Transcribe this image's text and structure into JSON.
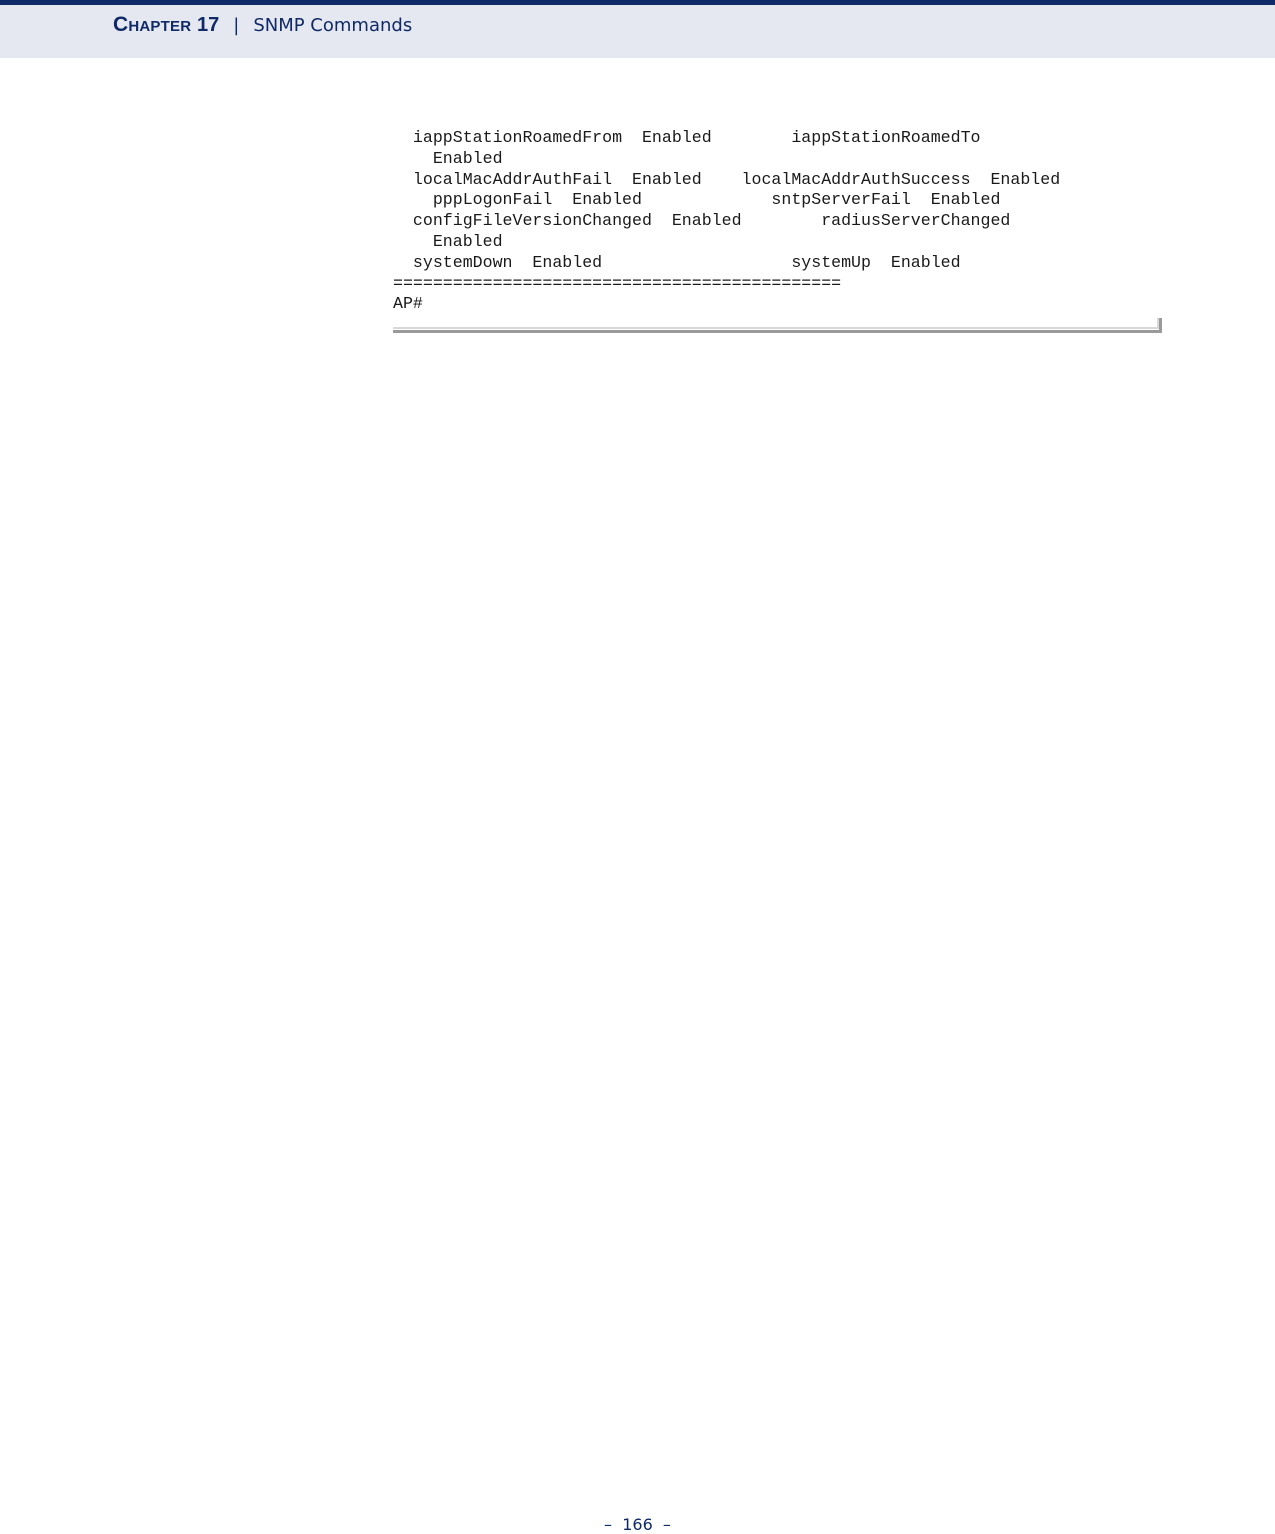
{
  "header": {
    "chapter_label": "Chapter",
    "chapter_number": "17",
    "separator": "|",
    "section_title": "SNMP Commands"
  },
  "code_example": {
    "lines": [
      "  iappStationRoamedFrom  Enabled        iappStationRoamedTo",
      "    Enabled",
      "  localMacAddrAuthFail  Enabled    localMacAddrAuthSuccess  Enabled",
      "    pppLogonFail  Enabled             sntpServerFail  Enabled",
      "  configFileVersionChanged  Enabled        radiusServerChanged",
      "    Enabled",
      "  systemDown  Enabled                   systemUp  Enabled",
      "=============================================",
      "AP#"
    ]
  },
  "footer": {
    "page_number": "–  166  –"
  }
}
